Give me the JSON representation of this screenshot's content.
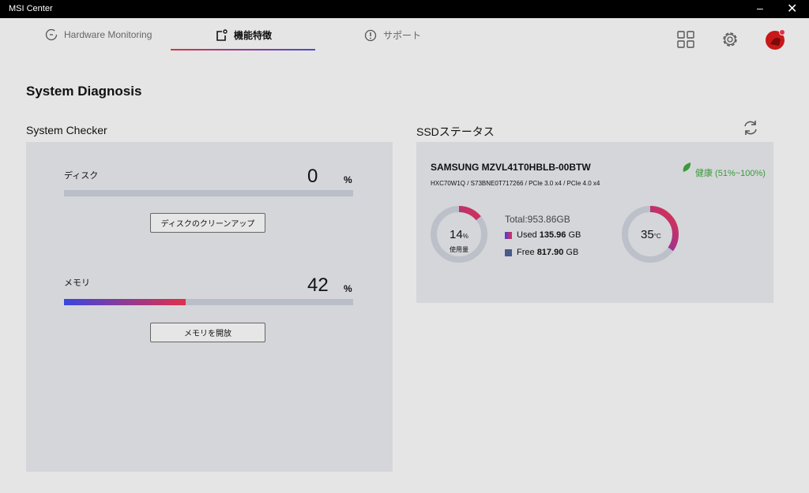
{
  "window": {
    "title": "MSI Center",
    "minimize": "–",
    "close": "✕"
  },
  "tabs": [
    {
      "label": "Hardware Monitoring"
    },
    {
      "label": "機能特徴"
    },
    {
      "label": "サポート"
    }
  ],
  "page_title": "System Diagnosis",
  "checker": {
    "title": "System Checker",
    "disk": {
      "label": "ディスク",
      "value": "0",
      "unit": "%",
      "fraction": 0,
      "button": "ディスクのクリーンアップ"
    },
    "memory": {
      "label": "メモリ",
      "value": "42",
      "unit": "%",
      "fraction": 0.42,
      "button": "メモリを開放"
    }
  },
  "ssd": {
    "title": "SSDステータス",
    "model": "SAMSUNG MZVL41T0HBLB-00BTW",
    "details": "HXC70W1Q / S73BNE0T717266 / PCIe 3.0 x4 / PCIe 4.0 x4",
    "health": "健康 (51%~100%)",
    "usage_value": "14",
    "usage_unit": "%",
    "usage_label": "使用量",
    "usage_fraction": 0.14,
    "total": "Total:953.86GB",
    "used_label": "Used",
    "used_value": "135.96",
    "free_label": "Free",
    "free_value": "817.90",
    "gb": "GB",
    "temp_value": "35",
    "temp_unit": "°C",
    "temp_fraction": 0.35
  },
  "colors": {
    "accent_red": "#e0304a",
    "accent_blue": "#4a4ad8",
    "health_green": "#3a9a3a",
    "free_color": "#4a5a8a"
  }
}
